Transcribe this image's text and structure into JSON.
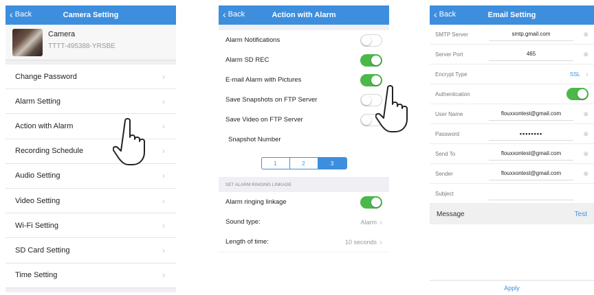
{
  "screen1": {
    "back": "Back",
    "title": "Camera Setting",
    "camera_name": "Camera",
    "camera_uid": "TTTT-495388-YRSBE",
    "menu": [
      "Change Password",
      "Alarm Setting",
      "Action with Alarm",
      "Recording Schedule",
      "Audio Setting",
      "Video Setting",
      "Wi-Fi Setting",
      "SD Card Setting",
      "Time Setting"
    ]
  },
  "screen2": {
    "back": "Back",
    "title": "Action with Alarm",
    "toggles": [
      {
        "label": "Alarm Notifications",
        "on": false
      },
      {
        "label": "Alarm SD REC",
        "on": true
      },
      {
        "label": "E-mail Alarm with Pictures",
        "on": true
      },
      {
        "label": "Save Snapshots on FTP Server",
        "on": false
      },
      {
        "label": "Save Video on FTP Server",
        "on": false
      }
    ],
    "snapshot_label": "Snapshot Number",
    "snapshot_options": [
      "1",
      "2",
      "3"
    ],
    "snapshot_selected": "3",
    "section_header": "SET ALARM RINGING LINKAGE",
    "ringing_label": "Alarm ringing linkage",
    "ringing_on": true,
    "sound_label": "Sound type:",
    "sound_value": "Alarm",
    "length_label": "Length of time:",
    "length_value": "10 seconds"
  },
  "screen3": {
    "back": "Back",
    "title": "Email Setting",
    "fields": {
      "smtp_label": "SMTP Server",
      "smtp_value": "smtp.gmail.com",
      "port_label": "Server Port",
      "port_value": "465",
      "encrypt_label": "Encrypt Type",
      "encrypt_value": "SSL",
      "auth_label": "Authentication",
      "auth_on": true,
      "user_label": "User Name",
      "user_value": "flouxxontest@gmail.com",
      "password_label": "Password",
      "password_value": "••••••••",
      "sendto_label": "Send To",
      "sendto_value": "flouxxontest@gmail.com",
      "sender_label": "Sender",
      "sender_value": "flouxxontest@gmail.com",
      "subject_label": "Subject",
      "subject_value": ""
    },
    "message_label": "Message",
    "test_label": "Test",
    "apply_label": "Apply"
  },
  "colors": {
    "nav_blue": "#3e8ede",
    "toggle_green": "#4cb849"
  }
}
